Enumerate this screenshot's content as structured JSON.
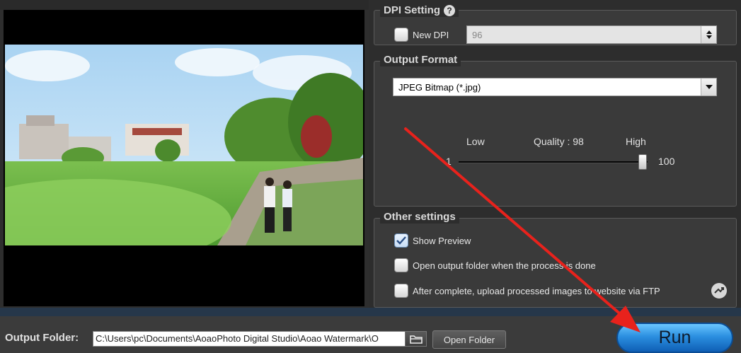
{
  "dpi_setting": {
    "title": "DPI Setting",
    "help_icon": "question-icon",
    "new_dpi_label": "New DPI",
    "new_dpi_checked": false,
    "dpi_value": "96"
  },
  "output_format": {
    "title": "Output Format",
    "format_value": "JPEG Bitmap (*.jpg)",
    "quality": {
      "low_label": "Low",
      "high_label": "High",
      "quality_text": "Quality : 98",
      "min": "1",
      "max": "100",
      "value": 98
    }
  },
  "other_settings": {
    "title": "Other settings",
    "show_preview_label": "Show Preview",
    "show_preview_checked": true,
    "open_folder_label": "Open output folder when the process is done",
    "open_folder_checked": false,
    "ftp_label": "After complete, upload processed images to website via FTP",
    "ftp_checked": false,
    "ftp_icon": "ftp-settings-icon"
  },
  "bottom": {
    "output_folder_label": "Output Folder:",
    "output_path": "C:\\Users\\pc\\Documents\\AoaoPhoto Digital Studio\\Aoao Watermark\\O",
    "browse_icon": "folder-browse-icon",
    "open_folder_button": "Open Folder",
    "run_button": "Run"
  },
  "colors": {
    "run_button": "#2b8fe0",
    "annotation_arrow": "#e8221c",
    "panel_bg": "#3a3a3a"
  }
}
